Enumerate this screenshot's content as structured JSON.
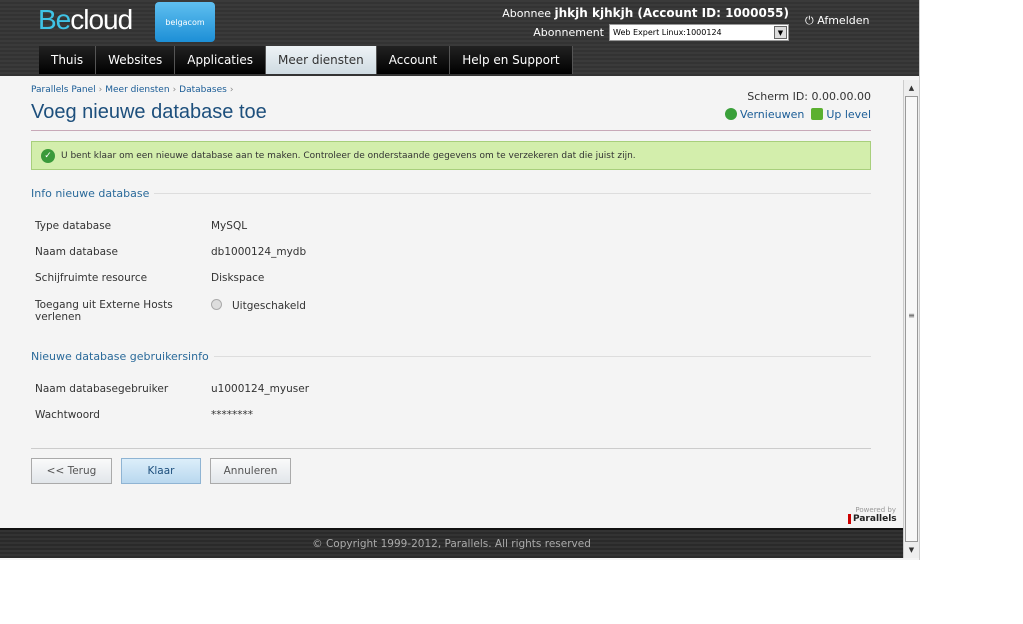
{
  "header": {
    "logo_be": "Be",
    "logo_cloud": "cloud",
    "partner": "belgacom",
    "subscriber_label": "Abonnee",
    "subscriber_value": "jhkjh kjhkjh (Account ID: 1000055)",
    "subscription_label": "Abonnement",
    "subscription_value": "Web Expert Linux:1000124",
    "logout": "Afmelden"
  },
  "nav": {
    "tabs": [
      {
        "label": "Thuis"
      },
      {
        "label": "Websites"
      },
      {
        "label": "Applicaties"
      },
      {
        "label": "Meer diensten",
        "active": true
      },
      {
        "label": "Account"
      },
      {
        "label": "Help en Support"
      }
    ]
  },
  "breadcrumb": [
    "Parallels Panel",
    "Meer diensten",
    "Databases"
  ],
  "page": {
    "title": "Voeg nieuwe database toe",
    "screen_id_label": "Scherm ID:",
    "screen_id": "0.00.00.00",
    "refresh": "Vernieuwen",
    "up_level": "Up level"
  },
  "message": "U bent klaar om een nieuwe database aan te maken. Controleer de onderstaande gegevens om te verzekeren dat die juist zijn.",
  "section1": {
    "title": "Info nieuwe database",
    "fields": [
      {
        "label": "Type database",
        "value": "MySQL"
      },
      {
        "label": "Naam database",
        "value": "db1000124_mydb"
      },
      {
        "label": "Schijfruimte resource",
        "value": "Diskspace"
      },
      {
        "label": "Toegang uit Externe Hosts verlenen",
        "value": "Uitgeschakeld"
      }
    ]
  },
  "section2": {
    "title": "Nieuwe database gebruikersinfo",
    "fields": [
      {
        "label": "Naam databasegebruiker",
        "value": "u1000124_myuser"
      },
      {
        "label": "Wachtwoord",
        "value": "********"
      }
    ]
  },
  "buttons": {
    "back": "<< Terug",
    "finish": "Klaar",
    "cancel": "Annuleren"
  },
  "powered": {
    "by": "Powered by",
    "brand": "Parallels"
  },
  "footer": "© Copyright 1999-2012, Parallels. All rights reserved",
  "colors": {
    "accent": "#1d4f7c",
    "success_bg": "#d3eeac",
    "header_bg": "#333333"
  }
}
